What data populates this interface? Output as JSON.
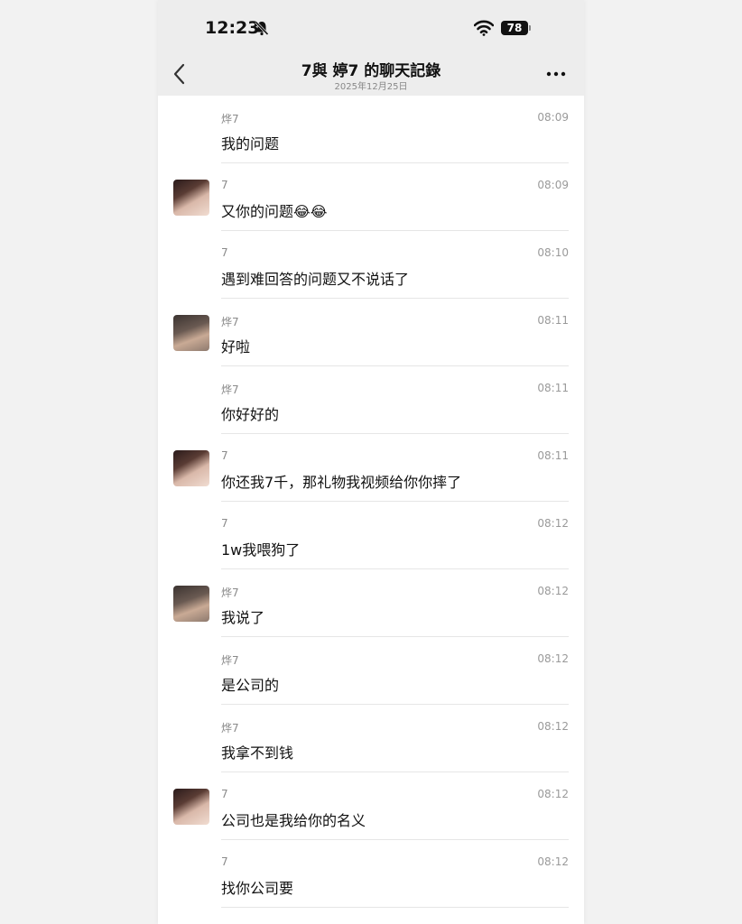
{
  "status": {
    "time": "12:23",
    "battery": "78"
  },
  "nav": {
    "title": "7與 婷7 的聊天記錄",
    "subtitle": "2025年12月25日"
  },
  "messages": [
    {
      "sender": "烨7",
      "time": "08:09",
      "text": "我的问题",
      "avatar": ""
    },
    {
      "sender": "7",
      "time": "08:09",
      "text": "又你的问题😂😂",
      "avatar": "girl"
    },
    {
      "sender": "7",
      "time": "08:10",
      "text": "遇到难回答的问题又不说话了",
      "avatar": ""
    },
    {
      "sender": "烨7",
      "time": "08:11",
      "text": "好啦",
      "avatar": "boy"
    },
    {
      "sender": "烨7",
      "time": "08:11",
      "text": "你好好的",
      "avatar": ""
    },
    {
      "sender": "7",
      "time": "08:11",
      "text": "你还我7千，那礼物我视频给你你摔了",
      "avatar": "girl"
    },
    {
      "sender": "7",
      "time": "08:12",
      "text": "1w我喂狗了",
      "avatar": ""
    },
    {
      "sender": "烨7",
      "time": "08:12",
      "text": "我说了",
      "avatar": "boy"
    },
    {
      "sender": "烨7",
      "time": "08:12",
      "text": "是公司的",
      "avatar": ""
    },
    {
      "sender": "烨7",
      "time": "08:12",
      "text": "我拿不到钱",
      "avatar": ""
    },
    {
      "sender": "7",
      "time": "08:12",
      "text": "公司也是我给你的名义",
      "avatar": "girl"
    },
    {
      "sender": "7",
      "time": "08:12",
      "text": "找你公司要",
      "avatar": ""
    }
  ]
}
